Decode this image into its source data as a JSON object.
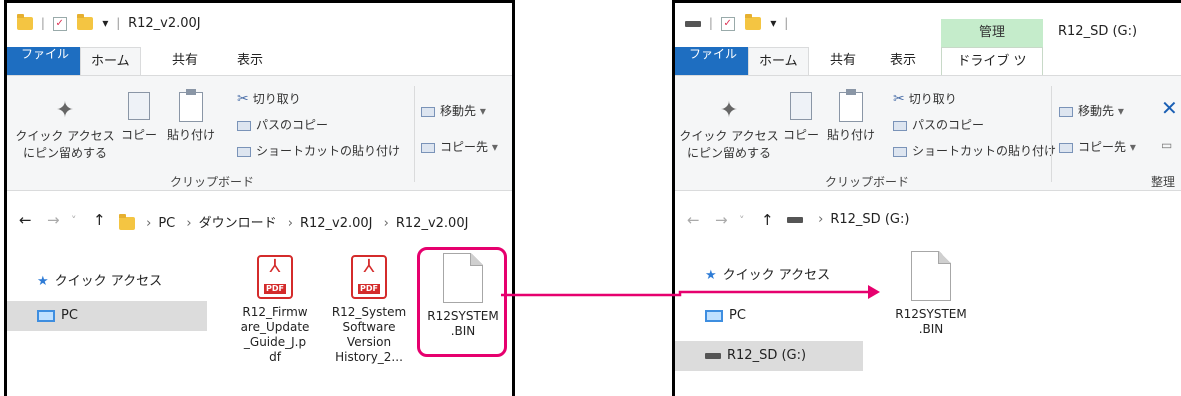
{
  "left_window": {
    "title": "R12_v2.00J",
    "tabs": [
      "ファイル",
      "ホーム",
      "共有",
      "表示"
    ],
    "ribbon": {
      "pin_label_1": "クイック アクセス",
      "pin_label_2": "にピン留めする",
      "copy": "コピー",
      "paste": "貼り付け",
      "cut": "切り取り",
      "copy_path": "パスのコピー",
      "paste_shortcut": "ショートカットの貼り付け",
      "move_to": "移動先",
      "copy_to": "コピー先",
      "group_clipboard": "クリップボード"
    },
    "address": [
      "PC",
      "ダウンロード",
      "R12_v2.00J",
      "R12_v2.00J"
    ],
    "nav": [
      "クイック アクセス",
      "PC"
    ],
    "files": [
      {
        "name": "R12_Firmware_Update_Guide_J.pdf",
        "lines": [
          "R12_Firmw",
          "are_Update",
          "_Guide_J.p",
          "df"
        ],
        "icon": "pdf-icon"
      },
      {
        "name": "R12_System Software Version History_2...",
        "lines": [
          "R12_System",
          "Software",
          "Version",
          "History_2..."
        ],
        "icon": "pdf-icon"
      },
      {
        "name": "R12SYSTEM.BIN",
        "lines": [
          "R12SYSTEM",
          ".BIN"
        ],
        "icon": "file-icon"
      }
    ],
    "pdf_tag": "PDF"
  },
  "right_window": {
    "title": "R12_SD (G:)",
    "tabs": [
      "ファイル",
      "ホーム",
      "共有",
      "表示"
    ],
    "manage_tab": "管理",
    "drive_tools_tab": "ドライブ ツール",
    "ribbon": {
      "pin_label_1": "クイック アクセス",
      "pin_label_2": "にピン留めする",
      "copy": "コピー",
      "paste": "貼り付け",
      "cut": "切り取り",
      "copy_path": "パスのコピー",
      "paste_shortcut": "ショートカットの貼り付け",
      "move_to": "移動先",
      "copy_to": "コピー先",
      "group_clipboard": "クリップボード",
      "group_organize": "整理"
    },
    "address": [
      "R12_SD (G:)"
    ],
    "nav": [
      "クイック アクセス",
      "PC",
      "R12_SD (G:)"
    ],
    "files": [
      {
        "name": "R12SYSTEM.BIN",
        "lines": [
          "R12SYSTEM",
          ".BIN"
        ],
        "icon": "file-icon"
      }
    ]
  },
  "colors": {
    "highlight": "#e6006e",
    "file_tab": "#1e6ec1",
    "manage_tab": "#c5eccb"
  }
}
